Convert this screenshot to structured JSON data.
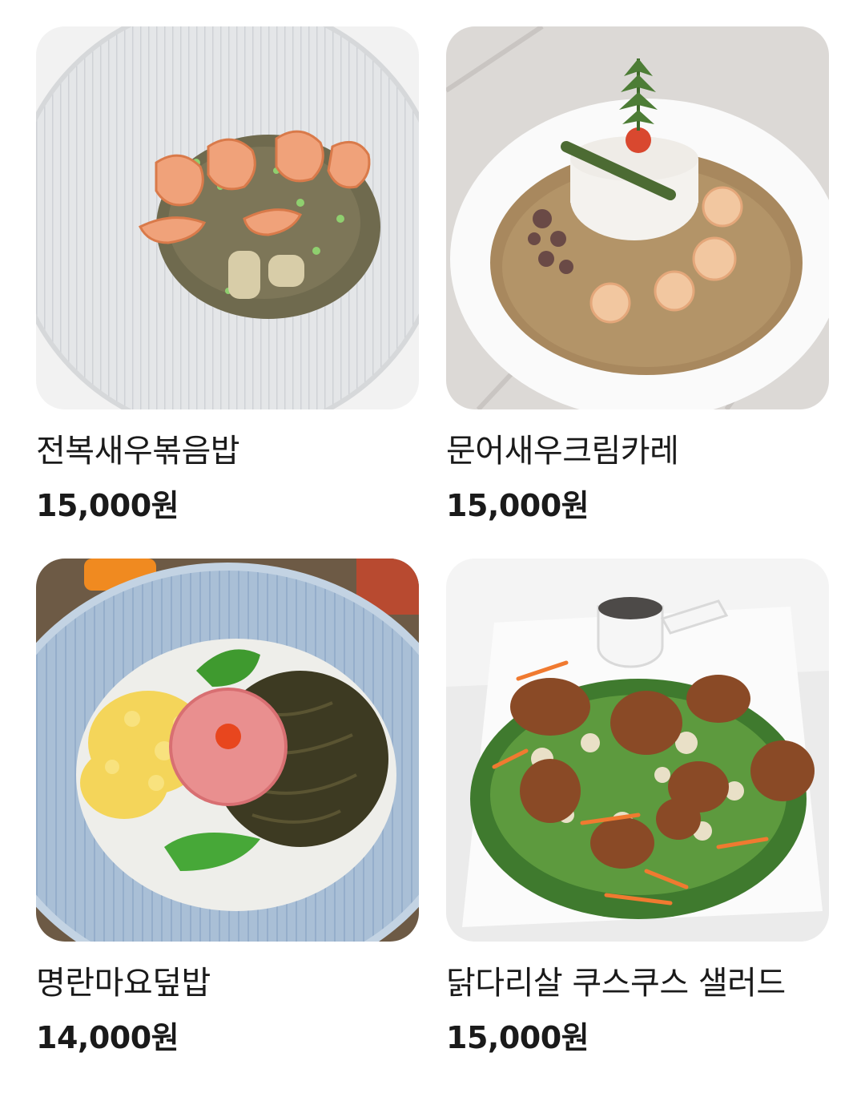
{
  "menu": {
    "items": [
      {
        "name": "전복새우볶음밥",
        "price": "15,000원",
        "image": "abalone-shrimp-fried-rice-photo"
      },
      {
        "name": "문어새우크림카레",
        "price": "15,000원",
        "image": "octopus-shrimp-cream-curry-photo"
      },
      {
        "name": "명란마요덮밥",
        "price": "14,000원",
        "image": "pollock-roe-mayo-rice-bowl-photo"
      },
      {
        "name": "닭다리살 쿠스쿠스 샐러드",
        "price": "15,000원",
        "image": "chicken-thigh-couscous-salad-photo"
      }
    ]
  },
  "colors": {
    "text": "#1a1a1a",
    "background": "#ffffff"
  }
}
